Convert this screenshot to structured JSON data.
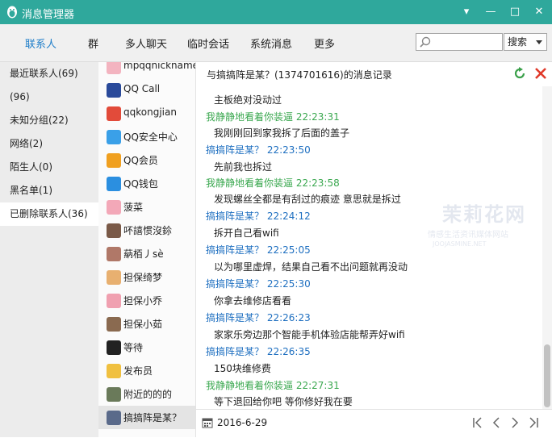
{
  "window": {
    "title": "消息管理器",
    "minimize": "▾",
    "restore": "—",
    "maximize": "□",
    "close": "✕"
  },
  "tabs": [
    "联系人",
    "群",
    "多人聊天",
    "临时会话",
    "系统消息",
    "更多"
  ],
  "search": {
    "placeholder": "",
    "button": "搜索"
  },
  "groups": [
    "最近联系人(69)",
    "(96)",
    "未知分组(22)",
    "网络(2)",
    "陌生人(0)",
    "黑名单(1)",
    "已删除联系人(36)"
  ],
  "contacts": [
    {
      "name": "mpqqnickname",
      "icon": "pig-avatar",
      "color": "#f3b4c0"
    },
    {
      "name": "QQ Call",
      "icon": "flag-avatar",
      "color": "#2a4a9a"
    },
    {
      "name": "qqkongjian",
      "icon": "star-avatar",
      "color": "#e24b3a"
    },
    {
      "name": "QQ安全中心",
      "icon": "shield-avatar",
      "color": "#3aa0e8"
    },
    {
      "name": "QQ会员",
      "icon": "penguin-avatar",
      "color": "#f0a020"
    },
    {
      "name": "QQ钱包",
      "icon": "wallet-avatar",
      "color": "#2b8fe0"
    },
    {
      "name": "菠菜",
      "icon": "pig-avatar",
      "color": "#f3a8b8"
    },
    {
      "name": "吥譆惯沒鉩",
      "icon": "photo-avatar",
      "color": "#7a5a48"
    },
    {
      "name": "蒳栢丿sè",
      "icon": "photo-avatar",
      "color": "#b07868"
    },
    {
      "name": "担保绮梦",
      "icon": "cartoon-avatar",
      "color": "#e8b070"
    },
    {
      "name": "担保小乔",
      "icon": "pig-avatar",
      "color": "#f0a0b0"
    },
    {
      "name": "担保小茹",
      "icon": "photo-avatar",
      "color": "#8a6a50"
    },
    {
      "name": "等待",
      "icon": "penguin-avatar",
      "color": "#222222"
    },
    {
      "name": "发布员",
      "icon": "dog-avatar",
      "color": "#f0c040"
    },
    {
      "name": "附近的的的",
      "icon": "photo-avatar",
      "color": "#6a7a5a"
    },
    {
      "name": "搞搞阵是某？",
      "icon": "photo-avatar",
      "color": "#5a6a8a"
    }
  ],
  "history": {
    "title": "与搞搞阵是某？(1374701616)的消息记录",
    "messages": [
      {
        "type": "text",
        "text": "主板绝对没动过"
      },
      {
        "type": "head",
        "sender": "我静静地看着你装逼",
        "time": "22:23:31",
        "color": "green"
      },
      {
        "type": "text",
        "text": "我刚刚回到家我拆了后面的盖子"
      },
      {
        "type": "head",
        "sender": "搞搞阵是某？",
        "time": "22:23:50",
        "color": "blue"
      },
      {
        "type": "text",
        "text": "先前我也拆过"
      },
      {
        "type": "head",
        "sender": "我静静地看着你装逼",
        "time": "22:23:58",
        "color": "green"
      },
      {
        "type": "text",
        "text": "发现螺丝全都是有刮过的痕迹 意思就是拆过"
      },
      {
        "type": "head",
        "sender": "搞搞阵是某？",
        "time": "22:24:12",
        "color": "blue"
      },
      {
        "type": "text",
        "text": "拆开自己看wifi"
      },
      {
        "type": "head",
        "sender": "搞搞阵是某？",
        "time": "22:25:05",
        "color": "blue"
      },
      {
        "type": "text",
        "text": "以为哪里虚焊，结果自己看不出问题就再没动"
      },
      {
        "type": "head",
        "sender": "搞搞阵是某？",
        "time": "22:25:30",
        "color": "blue"
      },
      {
        "type": "text",
        "text": "你拿去维修店看看"
      },
      {
        "type": "head",
        "sender": "搞搞阵是某？",
        "time": "22:26:23",
        "color": "blue"
      },
      {
        "type": "text",
        "text": "家家乐旁边那个智能手机体验店能帮弄好wifi"
      },
      {
        "type": "head",
        "sender": "搞搞阵是某？",
        "time": "22:26:35",
        "color": "blue"
      },
      {
        "type": "text",
        "text": "150块维修费"
      },
      {
        "type": "head",
        "sender": "我静静地看着你装逼",
        "time": "22:27:31",
        "color": "green"
      },
      {
        "type": "text",
        "text": "等下退回给你吧 等你修好我在要"
      }
    ]
  },
  "footer": {
    "date": "2016-6-29"
  },
  "watermark": {
    "line1": "茉莉花网",
    "line2": "情感生活资讯媒体网站",
    "line3": "JOOJASMINE.NET"
  },
  "colors": {
    "titlebar": "#2fa89c",
    "accent": "#1f7ec9",
    "green_sender": "#3ba850",
    "blue_sender": "#1e6fc0"
  }
}
